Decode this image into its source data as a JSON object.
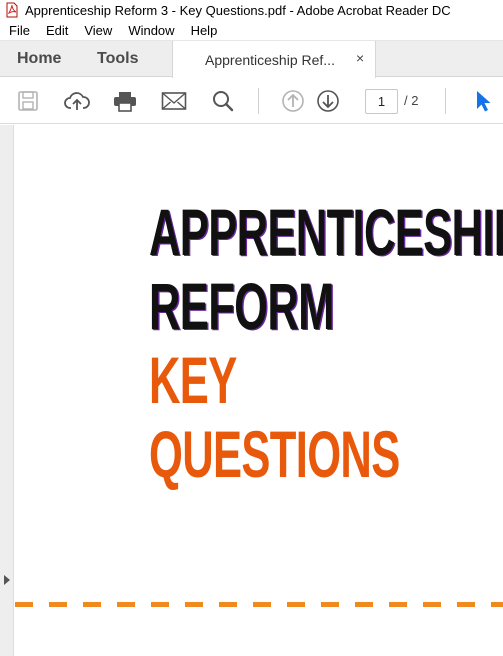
{
  "window": {
    "title": "Apprenticeship Reform 3 - Key Questions.pdf - Adobe Acrobat Reader DC",
    "app_icon": "acrobat-pdf-icon"
  },
  "menu": {
    "items": [
      "File",
      "Edit",
      "View",
      "Window",
      "Help"
    ]
  },
  "tabs": {
    "home": "Home",
    "tools": "Tools",
    "document": "Apprenticeship Ref...",
    "close_glyph": "×"
  },
  "toolbar": {
    "icons": [
      "save-icon",
      "cloud-upload-icon",
      "print-icon",
      "email-icon",
      "search-icon",
      "page-up-icon",
      "page-down-icon",
      "select-pointer-icon"
    ],
    "page_current": "1",
    "page_total": "/ 2"
  },
  "document": {
    "heading_lines": [
      "APPRENTICESHIP",
      "REFORM"
    ],
    "highlight_lines": [
      "KEY",
      "QUESTIONS"
    ],
    "colors": {
      "heading": "#111111",
      "highlight": "#e8590c",
      "dash": "#f08a1f",
      "pointer": "#1473e6"
    }
  }
}
